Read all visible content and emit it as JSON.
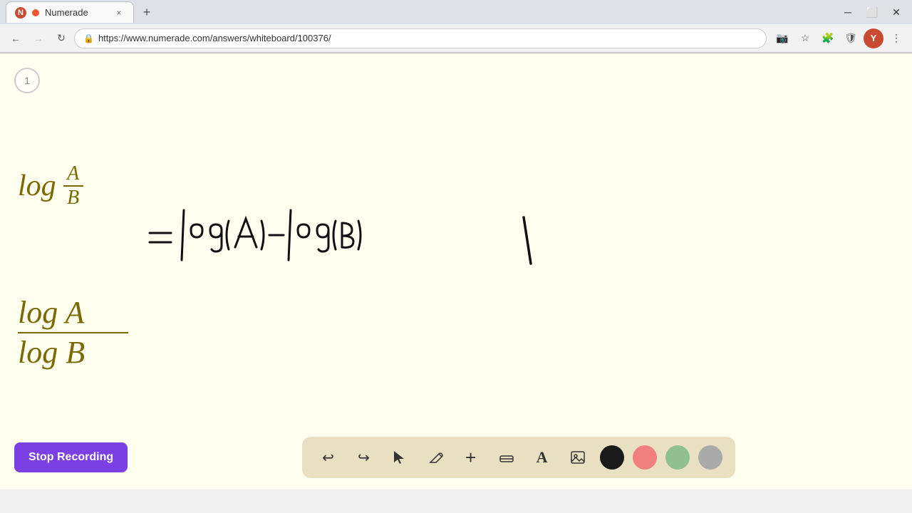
{
  "browser": {
    "tab": {
      "favicon_letter": "N",
      "title": "Numerade",
      "close_label": "×"
    },
    "new_tab_label": "+",
    "nav": {
      "back_label": "←",
      "forward_label": "→",
      "reload_label": "↻",
      "url": "https://www.numerade.com/answers/whiteboard/100376/",
      "lock_icon": "🔒",
      "bookmark_icon": "☆",
      "profile_letter": "Y",
      "menu_icon": "⋮"
    }
  },
  "whiteboard": {
    "page_number": "1",
    "formula_top": {
      "log_label": "log",
      "numerator": "A",
      "denominator": "B",
      "equals": "=",
      "handwritten": "log(A)−log(B)"
    },
    "formula_bottom": {
      "log_label1": "log A",
      "log_label2": "log B"
    }
  },
  "toolbar": {
    "stop_recording_label": "Stop Recording",
    "tools": {
      "undo_label": "↩",
      "redo_label": "↪",
      "select_label": "▲",
      "pen_label": "✏",
      "add_label": "+",
      "eraser_label": "◫",
      "text_label": "A",
      "image_label": "🖼"
    },
    "colors": [
      {
        "name": "black",
        "hex": "#1a1a1a"
      },
      {
        "name": "pink",
        "hex": "#f08080"
      },
      {
        "name": "green",
        "hex": "#90c090"
      },
      {
        "name": "gray",
        "hex": "#aaaaaa"
      }
    ]
  }
}
